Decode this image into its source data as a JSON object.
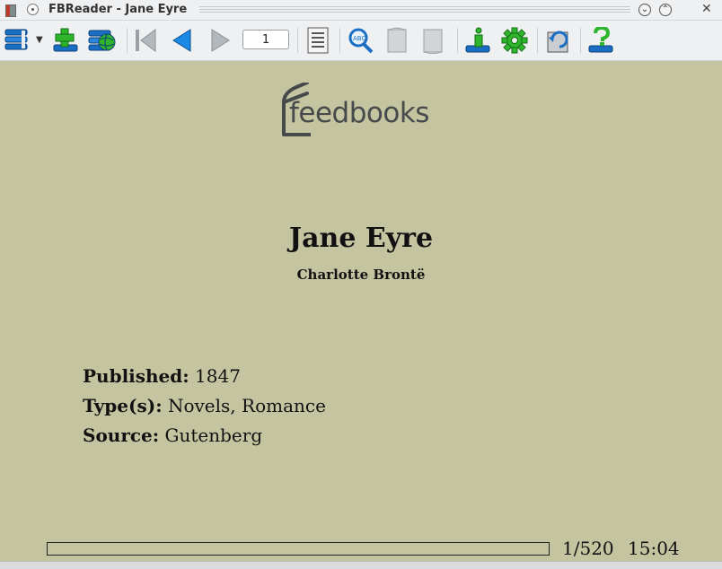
{
  "window": {
    "title": "FBReader - Jane Eyre"
  },
  "toolbar": {
    "page_number": "1",
    "buttons": [
      "library-icon",
      "add-book-icon",
      "network-library-icon",
      "go-first-icon",
      "go-back-icon",
      "go-forward-icon",
      "table-of-contents-icon",
      "search-icon",
      "page-up-icon",
      "page-down-icon",
      "book-info-icon",
      "preferences-icon",
      "rotate-icon",
      "help-icon"
    ]
  },
  "content": {
    "logo_text": "feedbooks",
    "title": "Jane Eyre",
    "author": "Charlotte Brontë",
    "published_label": "Published:",
    "published_value": "1847",
    "types_label": "Type(s):",
    "types_value": "Novels, Romance",
    "source_label": "Source:",
    "source_value": "Gutenberg"
  },
  "status": {
    "page_info": "1/520",
    "clock": "15:04",
    "progress_fraction": 0.0
  },
  "colors": {
    "page_background": "#c4c5a0",
    "toolbar_background": "#eef0f2",
    "icon_blue": "#1a6fc4",
    "icon_green": "#2fb52c"
  }
}
